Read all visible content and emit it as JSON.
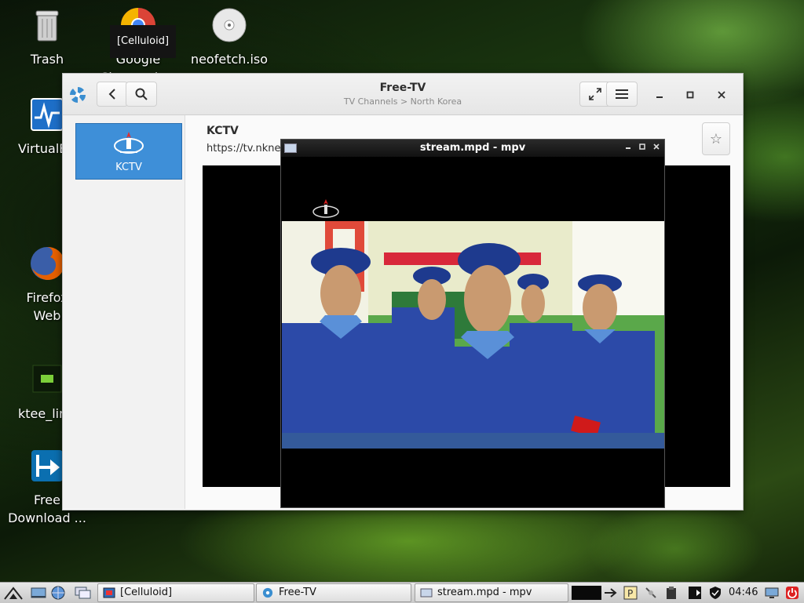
{
  "desktop": {
    "icons": [
      {
        "label": "Trash"
      },
      {
        "label": "Google Chrome (v..."
      },
      {
        "label": "neofetch.iso"
      },
      {
        "label": "VirtualBox"
      },
      {
        "label": "Firefox Web Browser"
      },
      {
        "label": "ktee_linux_mint.png"
      },
      {
        "label": "Free Download ..."
      }
    ],
    "tooltip": "[Celluloid]"
  },
  "freetv": {
    "title": "Free-TV",
    "breadcrumb": "TV Channels > North Korea",
    "channel": {
      "name": "KCTV"
    },
    "content": {
      "title": "KCTV",
      "url": "https://tv.nknews"
    }
  },
  "mpv": {
    "title": "stream.mpd - mpv"
  },
  "taskbar": {
    "tasks": [
      {
        "label": "[Celluloid]"
      },
      {
        "label": "Free-TV"
      },
      {
        "label": "stream.mpd - mpv"
      }
    ],
    "clock": "04:46"
  },
  "colors": {
    "accent": "#3e8fd8",
    "header": "#ececec",
    "mpv_bar": "#1a1a1a"
  }
}
